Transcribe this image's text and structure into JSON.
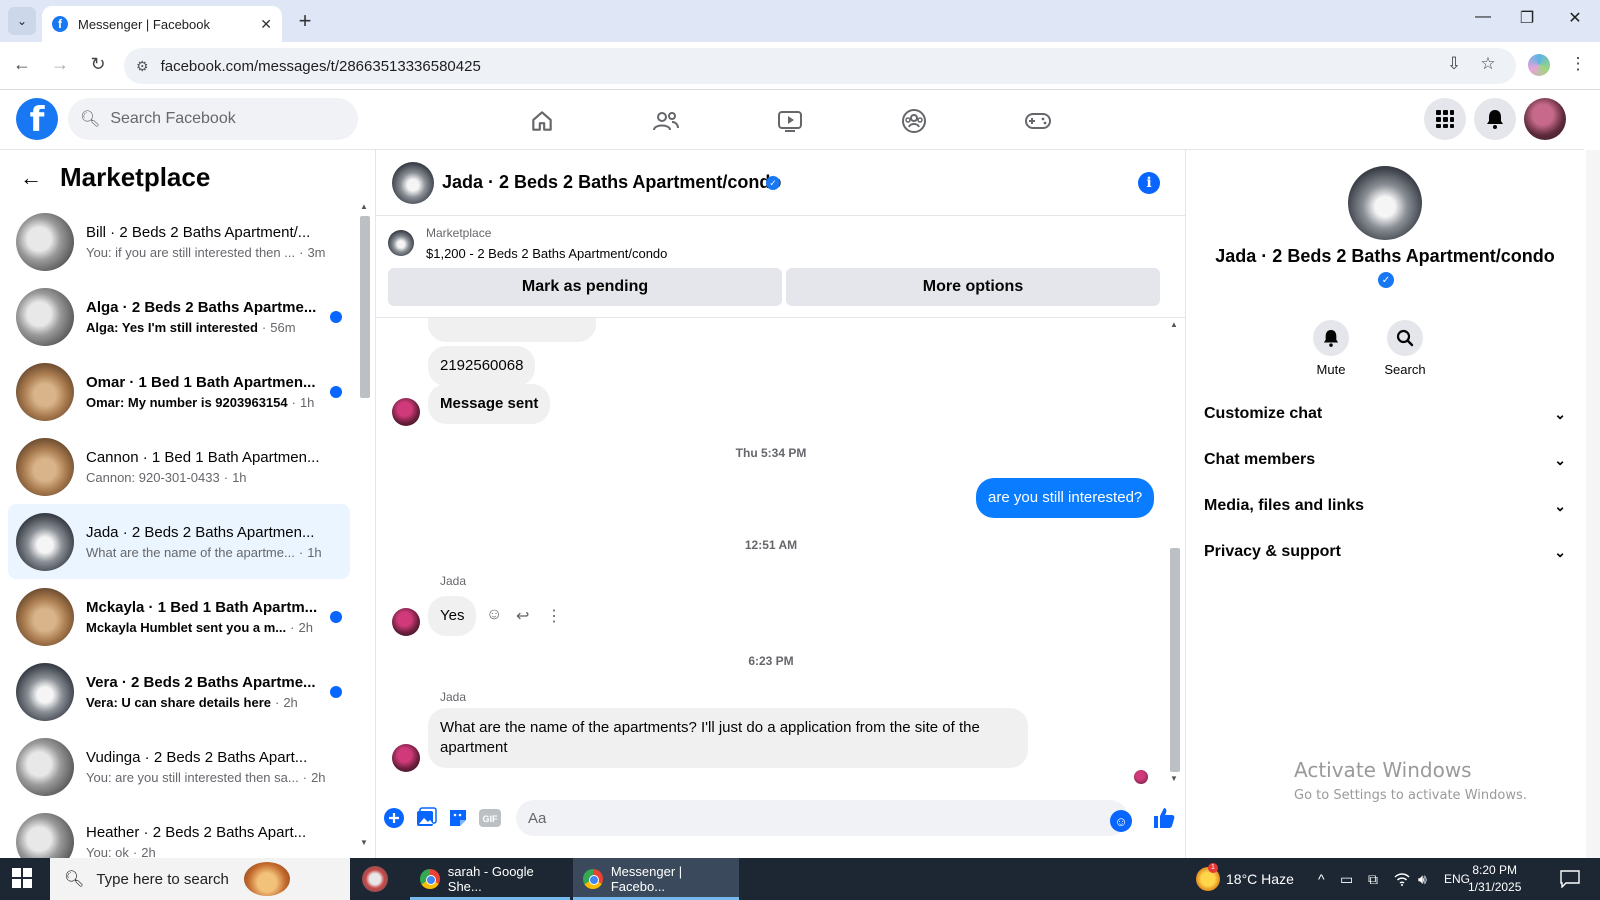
{
  "browser": {
    "tab_title": "Messenger | Facebook",
    "url": "facebook.com/messages/t/28663513336580425"
  },
  "fb": {
    "search_placeholder": "Search Facebook"
  },
  "sidebar": {
    "title": "Marketplace",
    "conversations": [
      {
        "name": "Bill · 2 Beds 2 Baths Apartment/...",
        "preview": "You: if you are still interested then ...",
        "time": "3m",
        "unread": false,
        "thumb": "a"
      },
      {
        "name": "Alga · 2 Beds 2 Baths Apartme...",
        "preview": "Alga: Yes I'm still interested",
        "time": "56m",
        "unread": true,
        "thumb": "a"
      },
      {
        "name": "Omar · 1 Bed 1 Bath Apartmen...",
        "preview": "Omar: My number is 9203963154",
        "time": "1h",
        "unread": true,
        "thumb": "b"
      },
      {
        "name": "Cannon · 1 Bed 1 Bath Apartmen...",
        "preview": "Cannon: 920-301-0433",
        "time": "1h",
        "unread": false,
        "thumb": "b"
      },
      {
        "name": "Jada · 2 Beds 2 Baths Apartmen...",
        "preview": "What are the name of the apartme...",
        "time": "1h",
        "unread": false,
        "thumb": "c",
        "active": true
      },
      {
        "name": "Mckayla · 1 Bed 1 Bath Apartm...",
        "preview": "Mckayla Humblet sent you a m...",
        "time": "2h",
        "unread": true,
        "thumb": "b"
      },
      {
        "name": "Vera · 2 Beds 2 Baths Apartme...",
        "preview": "Vera: U can share details here",
        "time": "2h",
        "unread": true,
        "thumb": "c"
      },
      {
        "name": "Vudinga · 2 Beds 2 Baths Apart...",
        "preview": "You: are you still interested then sa...",
        "time": "2h",
        "unread": false,
        "thumb": "a"
      },
      {
        "name": "Heather · 2 Beds 2 Baths Apart...",
        "preview": "You: ok",
        "time": "2h",
        "unread": false,
        "thumb": "a"
      }
    ]
  },
  "chat": {
    "title": "Jada · 2 Beds 2 Baths Apartment/condo",
    "marketplace_label": "Marketplace",
    "listing": "$1,200 - 2 Beds 2 Baths Apartment/condo",
    "mark_pending": "Mark as pending",
    "more_options": "More options",
    "messages": {
      "phone": "2192560068",
      "sent": "Message sent",
      "ts1": "Thu 5:34 PM",
      "outgoing": "are you still interested?",
      "ts2": "12:51 AM",
      "sender1": "Jada",
      "yes": "Yes",
      "ts3": "6:23 PM",
      "sender2": "Jada",
      "question": "What are the name of the  apartments? I'll just do a application from the site of the apartment"
    },
    "composer_placeholder": "Aa"
  },
  "details": {
    "name": "Jada · 2 Beds 2 Baths Apartment/condo",
    "mute": "Mute",
    "search": "Search",
    "sections": [
      "Customize chat",
      "Chat members",
      "Media, files and links",
      "Privacy & support"
    ]
  },
  "watermark": {
    "line1": "Activate Windows",
    "line2": "Go to Settings to activate Windows."
  },
  "taskbar": {
    "search_placeholder": "Type here to search",
    "app1": "sarah - Google She...",
    "app2": "Messenger | Facebo...",
    "weather": "18°C  Haze",
    "lang": "ENG",
    "time": "8:20 PM",
    "date": "1/31/2025"
  }
}
